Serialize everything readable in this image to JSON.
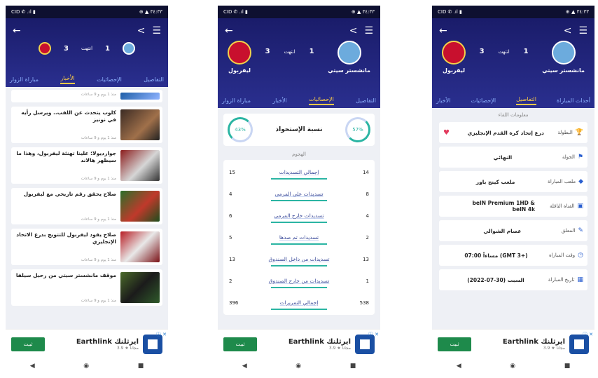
{
  "status": {
    "left": "CID ✆ .ıl ▮",
    "right": "⊕ ▲ ٣٤:٣٣"
  },
  "nav_icons": {
    "back": "◀",
    "home": "◉",
    "recent": "■"
  },
  "header": {
    "back_icon": "←",
    "share_icon": "<",
    "menu_icon": "☰"
  },
  "match": {
    "home_team": "مانشستر سيتي",
    "away_team": "ليفربول",
    "home_score": "1",
    "away_score": "3",
    "status": "انتهت",
    "home_color": "#6cabdd",
    "away_color": "#c8102e"
  },
  "screen1": {
    "tabs": [
      "مباراة الزوار",
      "الأخبار",
      "الإحصائيات",
      "التفاصيل"
    ],
    "active_tab": "الأخبار",
    "news": [
      {
        "title": "",
        "meta": "منذ 1 يوم و 9 ساعات"
      },
      {
        "title": "كلوب يتحدث عن اللقب.. ويرسل رأيه في نونيز",
        "meta": "منذ 1 يوم و 9 ساعات"
      },
      {
        "title": "جوارديولا: علينا تهنئة ليفربول، وهذا ما سيظهر هالاند",
        "meta": "منذ 1 يوم و 9 ساعات"
      },
      {
        "title": "صلاح يحقق رقم تاريخي مع ليفربول",
        "meta": "منذ 1 يوم و 9 ساعات"
      },
      {
        "title": "صلاح يقود ليفربول للتتويج بدرع الاتحاد الإنجليزي",
        "meta": "منذ 1 يوم و 9 ساعات"
      },
      {
        "title": "موقف مانشستر سيتي من رحيل سيلفا",
        "meta": "منذ 1 يوم و 9 ساعات"
      }
    ]
  },
  "screen2": {
    "tabs": [
      "مباراة الزوار",
      "الأخبار",
      "الإحصائيات",
      "التفاصيل"
    ],
    "active_tab": "الإحصائيات",
    "possession_title": "نسبة الإستحواذ",
    "possession_home": "57%",
    "possession_away": "43%",
    "section": "الهجوم",
    "stats": [
      {
        "label": "إجمالي التسديدات",
        "home": "14",
        "away": "15"
      },
      {
        "label": "تسديدات على المرمى",
        "home": "8",
        "away": "4"
      },
      {
        "label": "تسديدات خارج المرمى",
        "home": "4",
        "away": "6"
      },
      {
        "label": "تسديدات تم صدها",
        "home": "2",
        "away": "5"
      },
      {
        "label": "تسديدات من داخل الصندوق",
        "home": "13",
        "away": "13"
      },
      {
        "label": "تسديدات من خارج الصندوق",
        "home": "1",
        "away": "2"
      },
      {
        "label": "إجمالي التمريرات",
        "home": "538",
        "away": "396"
      }
    ]
  },
  "screen3": {
    "tabs": [
      "أحداث المباراة",
      "التفاصيل",
      "الإحصائيات",
      "الأخبار"
    ],
    "active_tab": "التفاصيل",
    "section": "معلومات اللقاء",
    "rows": [
      {
        "key": "البطولة",
        "value": "درع إتحاد كرة القدم الإنجليزي",
        "icon": "🏆"
      },
      {
        "key": "الجولة",
        "value": "النهائي",
        "icon": "⚑"
      },
      {
        "key": "ملعب المباراة",
        "value": "ملعب كينج باور",
        "icon": "◆"
      },
      {
        "key": "القناة الناقلة",
        "value": "beIN Premium 1HD & beIN 4k",
        "icon": "▣"
      },
      {
        "key": "المعلق",
        "value": "عصام الشوالي",
        "icon": "✎"
      },
      {
        "key": "وقت المباراة",
        "value": "07:00 مساءاً (GMT 3+)",
        "icon": "◷"
      },
      {
        "key": "تاريخ المباراة",
        "value": "السبت (30-07-2022)",
        "icon": "▦"
      }
    ]
  },
  "ad": {
    "button": "ثبيت",
    "title": "Earthlink ايرثلنك",
    "rating": "3.9 ★ مجاناً",
    "close": "ⓘ ✕"
  }
}
